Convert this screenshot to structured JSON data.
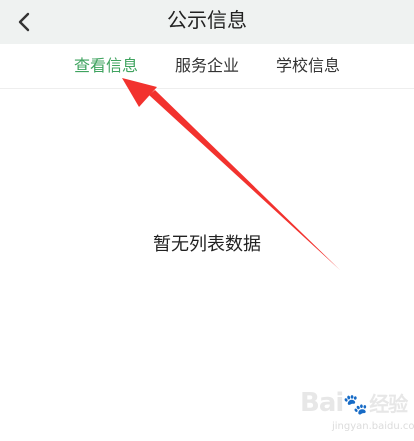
{
  "header": {
    "title": "公示信息",
    "back_icon": "chevron-left-icon"
  },
  "tabs": [
    {
      "label": "查看信息",
      "active": true
    },
    {
      "label": "服务企业",
      "active": false
    },
    {
      "label": "学校信息",
      "active": false
    }
  ],
  "content": {
    "empty_text": "暂无列表数据"
  },
  "annotation": {
    "icon": "red-arrow-annotation",
    "color": "#f2322e"
  },
  "watermark": {
    "brand_prefix": "Bai",
    "brand_suffix": "经验",
    "url": "jingyan.baidu.com"
  },
  "colors": {
    "header_bg": "#eff2f1",
    "active_tab": "#3fa35f",
    "text": "#333333"
  }
}
